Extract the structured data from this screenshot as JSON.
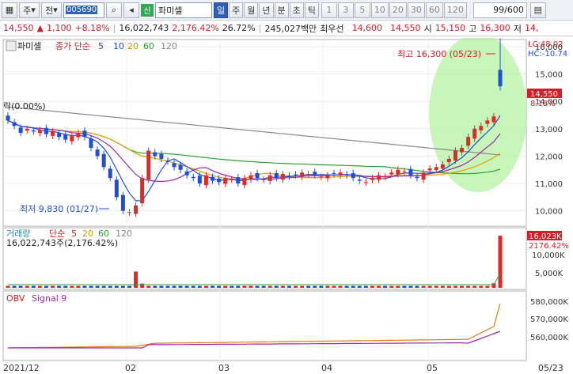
{
  "toolbar": {
    "market_select": "주",
    "period_select": "전",
    "stock_code": "005690",
    "stock_name": "파미셀",
    "badge": "신",
    "periods": [
      "일",
      "주",
      "월",
      "년",
      "분",
      "초",
      "틱"
    ],
    "active_period": "일",
    "intervals": [
      "1",
      "3",
      "5",
      "10",
      "20",
      "30",
      "60",
      "120"
    ],
    "page_counter": "99/600"
  },
  "quote": {
    "price": "14,550",
    "arrow": "▲",
    "change": "1,100",
    "change_pct": "+8.18%",
    "volume": "16,022,743",
    "volume_pct": "2,176.42%",
    "turnover": "26.72%",
    "amount": "245,027백만",
    "priority_label": "최우선",
    "bid": "14,600",
    "ask": "14,550",
    "open_label": "시",
    "open": "15,150",
    "high_label": "고",
    "high": "16,300",
    "low_label": "저",
    "low": "14,"
  },
  "price_panel": {
    "title": "파미셀",
    "ma_label": "종가 단순",
    "ma_periods": [
      "5",
      "10",
      "20",
      "60",
      "120"
    ],
    "ma_colors": [
      "#1f4fd8",
      "#b8a000",
      "#2ca02c",
      "#888888"
    ],
    "ref_label": "락(0.00%)",
    "high_note": "최고 16,300 (05/23)",
    "low_note": "최저 9,830 (01/27)",
    "lc_label": "LC:48.02",
    "hc_label": "HC:-10.74",
    "current_price": "14,550",
    "current_pct": "8.18%",
    "y_ticks": [
      "16,000",
      "15,000",
      "14,000",
      "13,000",
      "12,000",
      "11,000",
      "10,000"
    ]
  },
  "volume_panel": {
    "title": "거래량",
    "ma_label": "단순",
    "ma_periods": [
      "5",
      "20",
      "60",
      "120"
    ],
    "info": "16,022,743주(2,176.42%)",
    "current_vol": "16,023K",
    "current_pct": "2176.42%",
    "y_ticks": [
      "10,000K",
      "5,000K"
    ]
  },
  "obv_panel": {
    "title": "OBV",
    "signal": "Signal 9",
    "y_ticks": [
      "580,000K",
      "570,000K",
      "560,000K"
    ]
  },
  "x_axis": [
    "2021/12",
    "02",
    "03",
    "04",
    "05",
    "05/23"
  ],
  "chart_data": {
    "type": "candlestick",
    "symbol": "005690",
    "name": "파미셀",
    "last_close": 14550,
    "high": {
      "value": 16300,
      "date": "05/23"
    },
    "low": {
      "value": 9830,
      "date": "01/27"
    },
    "ylim": [
      9500,
      16200
    ],
    "closes": [
      13300,
      13100,
      12850,
      13000,
      12900,
      12950,
      12800,
      12900,
      12700,
      12600,
      12750,
      12850,
      12700,
      12300,
      12000,
      11600,
      11200,
      10500,
      10000,
      9950,
      10200,
      11200,
      12200,
      12000,
      11900,
      11800,
      11600,
      11500,
      11300,
      11200,
      11000,
      11300,
      11100,
      11050,
      11200,
      11150,
      11000,
      11200,
      11300,
      11200,
      11150,
      11300,
      11200,
      11350,
      11250,
      11300,
      11400,
      11350,
      11300,
      11250,
      11300,
      11350,
      11400,
      11300,
      11200,
      11100,
      11050,
      11200,
      11300,
      11250,
      11400,
      11500,
      11450,
      11300,
      11200,
      11400,
      11550,
      11600,
      11700,
      11900,
      12200,
      12300,
      12700,
      13000,
      13100,
      13300,
      13450,
      14550
    ]
  }
}
